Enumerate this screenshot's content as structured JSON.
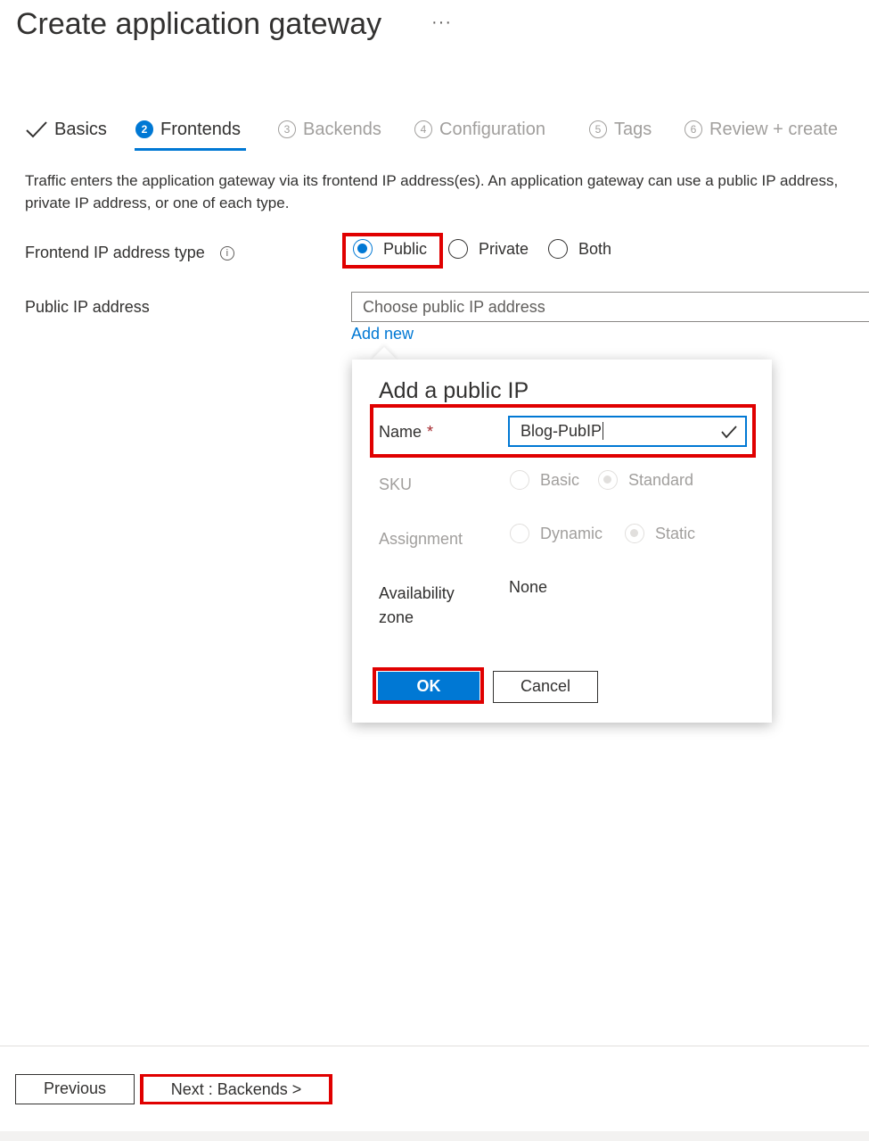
{
  "header": {
    "title": "Create application gateway",
    "more": "···"
  },
  "tabs": [
    {
      "num": "✓",
      "label": "Basics"
    },
    {
      "num": "2",
      "label": "Frontends"
    },
    {
      "num": "3",
      "label": "Backends"
    },
    {
      "num": "4",
      "label": "Configuration"
    },
    {
      "num": "5",
      "label": "Tags"
    },
    {
      "num": "6",
      "label": "Review + create"
    }
  ],
  "description": {
    "line1": "Traffic enters the application gateway via its frontend IP address(es). An application gateway can use a public IP address,",
    "line2": "private IP address, or one of each type."
  },
  "frontend_type": {
    "label": "Frontend IP address type",
    "info_icon": "i",
    "options": [
      "Public",
      "Private",
      "Both"
    ],
    "selected": "Public"
  },
  "public_ip": {
    "label": "Public IP address",
    "placeholder": "Choose public IP address",
    "add_new": "Add new"
  },
  "callout": {
    "title": "Add a public IP",
    "name_label": "Name",
    "required_mark": "*",
    "name_value": "Blog-PubIP",
    "sku_label": "SKU",
    "sku_options": [
      "Basic",
      "Standard"
    ],
    "sku_selected": "Standard",
    "assignment_label": "Assignment",
    "assignment_options": [
      "Dynamic",
      "Static"
    ],
    "assignment_selected": "Static",
    "az_label_line1": "Availability",
    "az_label_line2": "zone",
    "az_value": "None",
    "ok_label": "OK",
    "cancel_label": "Cancel"
  },
  "footer": {
    "previous_label": "Previous",
    "next_label": "Next : Backends >"
  },
  "colors": {
    "accent": "#0078d4",
    "highlight": "#e00000",
    "required": "#a4262c"
  }
}
